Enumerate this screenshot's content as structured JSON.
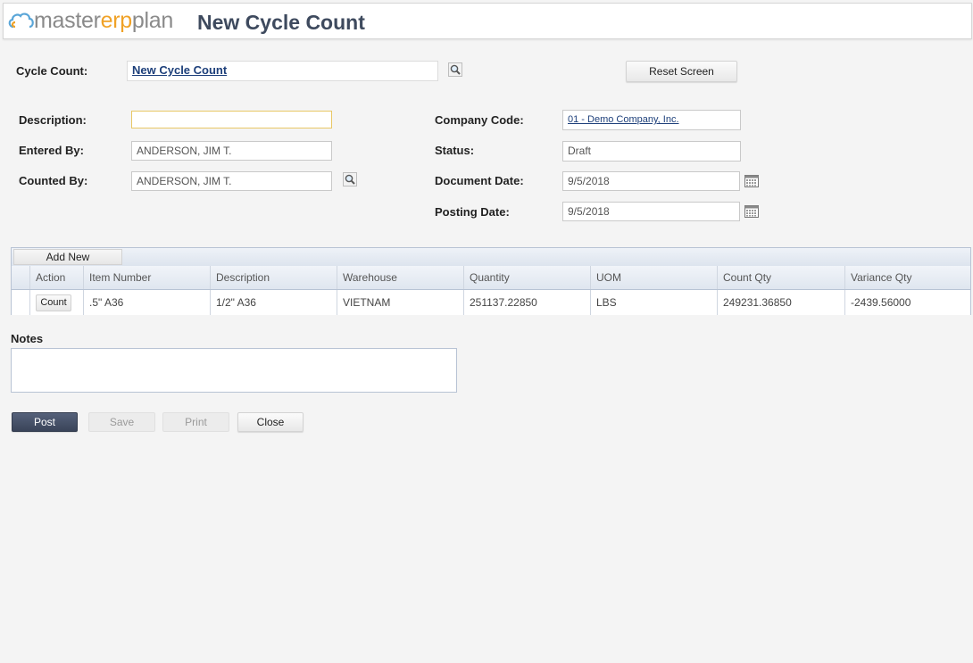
{
  "brand": {
    "logo_text_a": "masterpl",
    "logo_text_b": "an",
    "logo_text_m": "m",
    "logo_text_m2": "aster",
    "logo_text_erp": "erp"
  },
  "page_title": "New Cycle Count",
  "cycle_count": {
    "label": "Cycle Count:",
    "value": "New Cycle Count"
  },
  "reset_button": "Reset Screen",
  "form": {
    "description": {
      "label": "Description:",
      "value": ""
    },
    "entered_by": {
      "label": "Entered By:",
      "value": "ANDERSON, JIM T."
    },
    "counted_by": {
      "label": "Counted By:",
      "value": "ANDERSON, JIM T."
    },
    "company_code": {
      "label": "Company Code:",
      "value": "01 - Demo Company, Inc."
    },
    "status": {
      "label": "Status:",
      "value": "Draft"
    },
    "document_date": {
      "label": "Document Date:",
      "value": "9/5/2018"
    },
    "posting_date": {
      "label": "Posting Date:",
      "value": "9/5/2018"
    }
  },
  "grid": {
    "add_new_label": "Add New",
    "columns": [
      "Action",
      "Item Number",
      "Description",
      "Warehouse",
      "Quantity",
      "UOM",
      "Count Qty",
      "Variance Qty"
    ],
    "rows": [
      {
        "action": "Count",
        "item_number": ".5\" A36",
        "description": "1/2\" A36",
        "warehouse": "VIETNAM",
        "quantity": "251137.22850",
        "uom": "LBS",
        "count_qty": "249231.36850",
        "variance_qty": "-2439.56000"
      }
    ]
  },
  "notes": {
    "label": "Notes",
    "value": ""
  },
  "actions": {
    "post": "Post",
    "save": "Save",
    "print": "Print",
    "close": "Close"
  },
  "colors": {
    "brand_gray": "#8a8a8a",
    "brand_orange": "#f0a227",
    "title": "#3e4a5e",
    "primary_button": "#3a4459",
    "link": "#1d3f7a"
  },
  "icons": {
    "lookup": "magnifier-icon",
    "calendar": "calendar-icon",
    "logo_cloud": "cloud-icon"
  }
}
